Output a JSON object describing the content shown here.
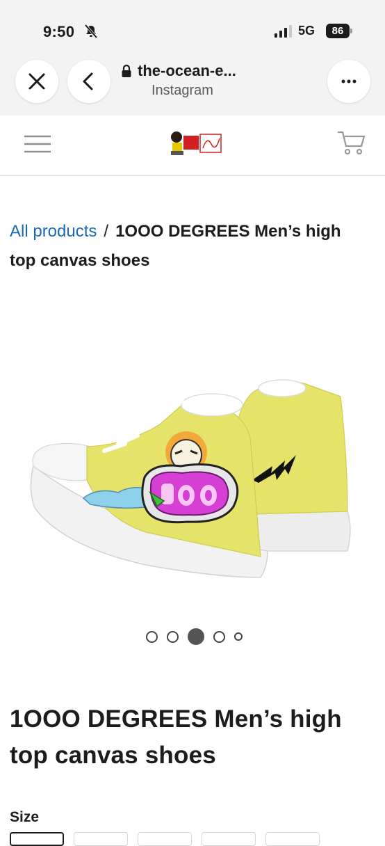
{
  "status_bar": {
    "time": "9:50",
    "network": "5G",
    "battery": "86"
  },
  "browser": {
    "url": "the-ocean-e...",
    "source": "Instagram"
  },
  "header": {
    "logo_icon": "joey-digital-logo",
    "menu_icon": "hamburger-icon",
    "cart_icon": "cart-icon"
  },
  "breadcrumb": {
    "link": "All products",
    "separator": "/",
    "current": "1OOO DEGREES Men’s high top canvas shoes"
  },
  "carousel": {
    "active_index": 2,
    "count": 5
  },
  "product": {
    "title": "1OOO DEGREES Men’s high top canvas shoes",
    "size_label": "Size"
  },
  "colors": {
    "link": "#1b69b6",
    "shoe_yellow": "#e6e36a",
    "chrome_bg": "#f3f3f3"
  }
}
